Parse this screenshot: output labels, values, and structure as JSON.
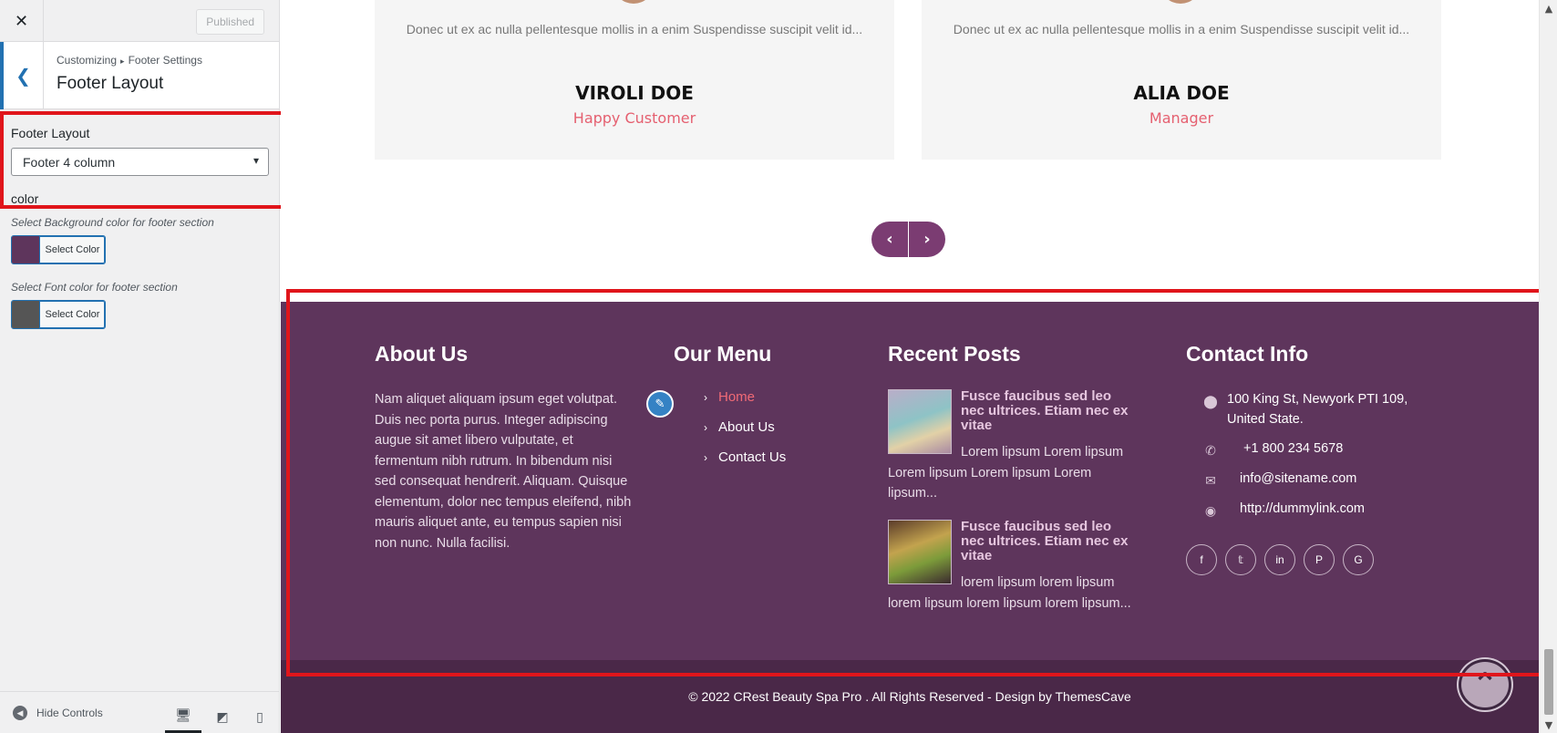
{
  "customizer": {
    "close_icon": "close-icon",
    "publish_label": "Published",
    "breadcrumb": {
      "root": "Customizing",
      "parent": "Footer Settings"
    },
    "section_title": "Footer Layout",
    "controls": {
      "footer_layout_label": "Footer Layout",
      "footer_layout_value": "Footer 4 column",
      "color_heading": "color",
      "bg_color_desc": "Select Background color for footer section",
      "bg_color_btn": "Select Color",
      "bg_color_value": "#5e355c",
      "font_color_desc": "Select Font color for footer section",
      "font_color_btn": "Select Color",
      "font_color_value": "#555555"
    },
    "footer_bar": {
      "hide_controls": "Hide Controls"
    }
  },
  "preview": {
    "testimonials": [
      {
        "text": "Donec ut ex ac nulla pellentesque mollis in a enim Suspendisse suscipit velit id...",
        "name": "VIROLI DOE",
        "role": "Happy Customer"
      },
      {
        "text": "Donec ut ex ac nulla pellentesque mollis in a enim Suspendisse suscipit velit id...",
        "name": "ALIA DOE",
        "role": "Manager"
      }
    ],
    "footer": {
      "about": {
        "heading": "About Us",
        "text": "Nam aliquet aliquam ipsum eget volutpat. Duis nec porta purus. Integer adipiscing augue sit amet libero vulputate, et fermentum nibh rutrum. In bibendum nisi sed consequat hendrerit. Aliquam. Quisque elementum, dolor nec tempus eleifend, nibh mauris aliquet ante, eu tempus sapien nisi non nunc. Nulla facilisi."
      },
      "menu": {
        "heading": "Our Menu",
        "items": [
          "Home",
          "About Us",
          "Contact Us"
        ]
      },
      "recent_posts": {
        "heading": "Recent Posts",
        "posts": [
          {
            "title": "Fusce faucibus sed leo nec ultrices. Etiam nec ex vitae",
            "excerpt": "Lorem lipsum Lorem lipsum Lorem lipsum Lorem lipsum Lorem lipsum..."
          },
          {
            "title": "Fusce faucibus sed leo nec ultrices. Etiam nec ex vitae",
            "excerpt": "lorem lipsum lorem lipsum lorem lipsum lorem lipsum lorem lipsum..."
          }
        ]
      },
      "contact": {
        "heading": "Contact Info",
        "address": "100 King St, Newyork PTI 109, United State.",
        "phone": "+1 800 234 5678",
        "email": "info@sitename.com",
        "website": "http://dummylink.com"
      },
      "copyright": "© 2022 CRest Beauty Spa Pro . All Rights Reserved - Design by ThemesCave"
    }
  }
}
